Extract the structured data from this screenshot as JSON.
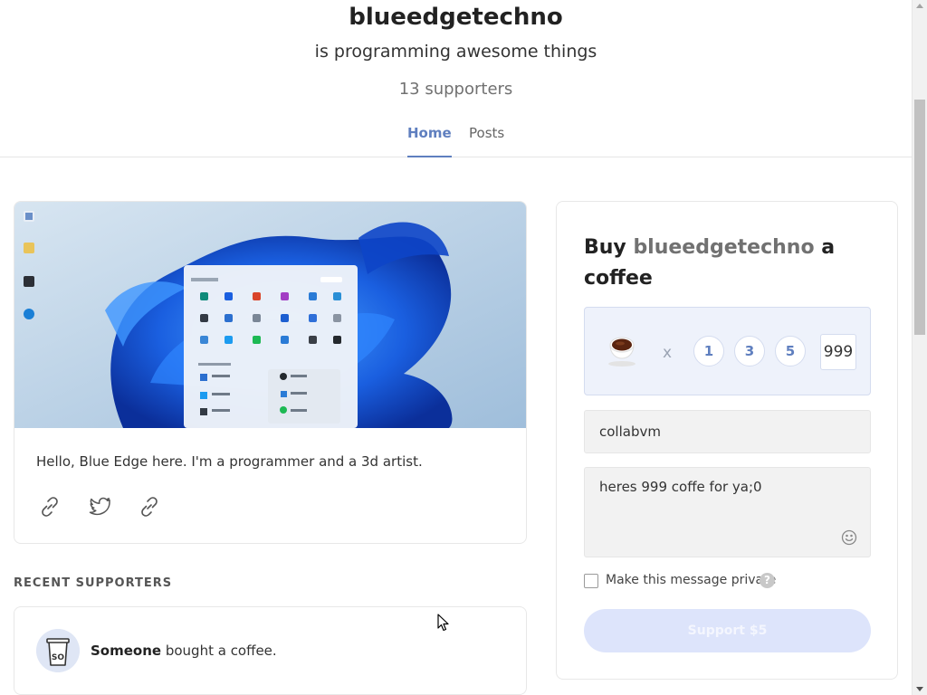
{
  "header": {
    "creator_name": "blueedgetechno",
    "tagline": "is programming awesome things",
    "supporters_count": "13 supporters",
    "tabs": [
      {
        "label": "Home",
        "active": true
      },
      {
        "label": "Posts",
        "active": false
      }
    ]
  },
  "about": {
    "text": "Hello, Blue Edge here. I'm a programmer and a 3d artist.",
    "social_icons": [
      "link-icon",
      "twitter-icon",
      "link-icon"
    ]
  },
  "recent_supporters": {
    "title": "RECENT SUPPORTERS",
    "items": [
      {
        "avatar_text": "SO",
        "name": "Someone",
        "action": " bought a coffee."
      }
    ]
  },
  "buy": {
    "title_prefix": "Buy ",
    "creator": "blueedgetechno",
    "title_suffix": " a coffee",
    "times": "x",
    "quantities": [
      "1",
      "3",
      "5"
    ],
    "custom_quantity": "999",
    "name_value": "collabvm",
    "message_value": "heres 999 coffe for ya;0",
    "private_label": "Make this message private",
    "help_symbol": "?",
    "support_button_label": "Support $5"
  },
  "colors": {
    "accent": "#5f7fbf",
    "qty_box_bg": "#eef2fb",
    "button_disabled": "#dde4fb"
  }
}
